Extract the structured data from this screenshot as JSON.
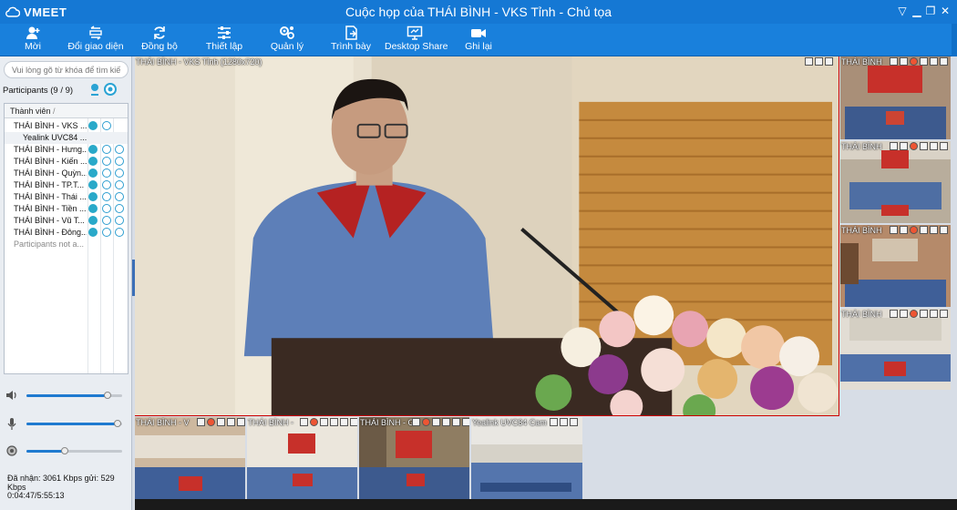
{
  "app": {
    "logo": "VMEET",
    "title": "Cuộc họp của THÁI BÌNH - VKS Tỉnh - Chủ tọa"
  },
  "toolbar": {
    "items": [
      {
        "label": "Mời",
        "icon": "invite-icon"
      },
      {
        "label": "Đổi giao diện",
        "icon": "layout-icon"
      },
      {
        "label": "Đồng bộ",
        "icon": "sync-icon"
      },
      {
        "label": "Thiết lập",
        "icon": "settings-icon"
      },
      {
        "label": "Quản lý",
        "icon": "manage-icon"
      },
      {
        "label": "Trình bày",
        "icon": "present-icon"
      },
      {
        "label": "Desktop Share",
        "icon": "desktop-share-icon"
      },
      {
        "label": "Ghi lại",
        "icon": "record-icon"
      }
    ]
  },
  "sidebar": {
    "search_placeholder": "Vui lòng gõ từ khóa để tìm kiế",
    "participants_label": "Participants (9 / 9)",
    "column_header": "Thành viên",
    "participants": [
      {
        "name": "THÁI BÌNH - VKS ...",
        "indent": false
      },
      {
        "name": "Yealink UVC84 ...",
        "indent": true
      },
      {
        "name": "THÁI BÌNH - Hưng...",
        "indent": false
      },
      {
        "name": "THÁI BÌNH - Kiến ...",
        "indent": false
      },
      {
        "name": "THÁI BÌNH - Quỳn...",
        "indent": false
      },
      {
        "name": "THÁI BÌNH - TP.T...",
        "indent": false
      },
      {
        "name": "THÁI BÌNH - Thái ...",
        "indent": false
      },
      {
        "name": "THÁI BÌNH - Tiền ...",
        "indent": false
      },
      {
        "name": "THÁI BÌNH - Vũ T...",
        "indent": false
      },
      {
        "name": "THÁI BÌNH - Đông...",
        "indent": false
      }
    ],
    "not_attended": "Participants not a...",
    "volume": {
      "speaker": 0.85,
      "mic": 0.95,
      "camera": 0.4
    },
    "stats": "Đã nhận: 3061 Kbps gửi: 529 Kbps",
    "timer": "0:04:47/5:55:13"
  },
  "main_video": {
    "label": "THÁI BÌNH - VKS Tỉnh (1280x720)"
  },
  "side_thumbs": [
    {
      "label": "THÁI BÌNH"
    },
    {
      "label": "THÁI BÌNH"
    },
    {
      "label": "THÁI BÌNH"
    },
    {
      "label": "THÁI BÌNH"
    }
  ],
  "bottom_thumbs": [
    {
      "label": "THÁI BÌNH - V"
    },
    {
      "label": "THÁI BÌNH -"
    },
    {
      "label": "THÁI BÌNH - G"
    },
    {
      "label": "Yealink UVC84 Cam"
    }
  ],
  "colors": {
    "titlebar": "#1578d4",
    "toolbar": "#1980dc",
    "accent": "#1f7ad0"
  }
}
